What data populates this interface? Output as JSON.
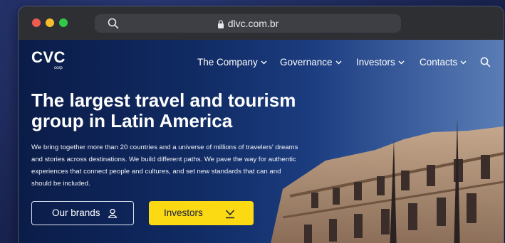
{
  "browser": {
    "url": "dlvc.com.br"
  },
  "site": {
    "logo": {
      "main": "CVC",
      "sub": "corp"
    },
    "nav": [
      {
        "label": "The Company"
      },
      {
        "label": "Governance"
      },
      {
        "label": "Investors"
      },
      {
        "label": "Contacts"
      }
    ],
    "hero": {
      "title": "The largest travel and tourism group in Latin America",
      "description": "We bring together more than 20 countries and a universe of millions of travelers' dreams and stories across destinations. We build different paths. We pave the way for authentic experiences that connect people and cultures, and set new standards that can and should be included.",
      "buttons": {
        "brands": "Our brands",
        "investors": "Investors"
      }
    }
  },
  "colors": {
    "accent": "#fbd913",
    "background": "#1c2756"
  },
  "icons": [
    "search-icon",
    "lock-icon",
    "chevron-down-icon",
    "user-brands-icon",
    "download-icon"
  ]
}
